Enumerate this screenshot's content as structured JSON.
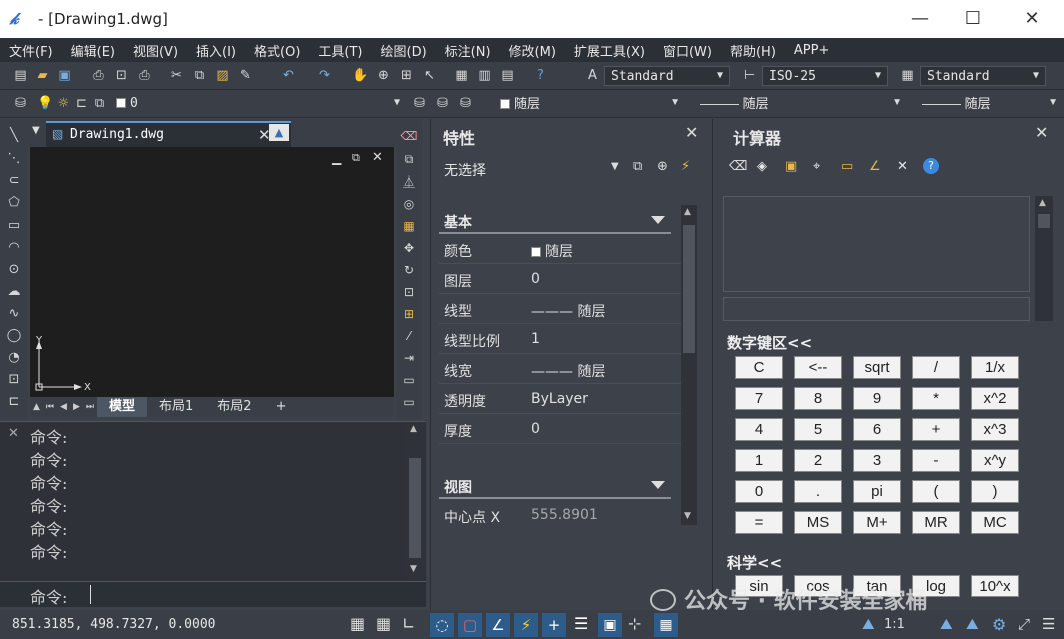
{
  "window": {
    "title": "- [Drawing1.dwg]",
    "logo": "𝓀",
    "min": "—",
    "max": "☐",
    "close": "✕"
  },
  "menu": [
    "文件(F)",
    "编辑(E)",
    "视图(V)",
    "插入(I)",
    "格式(O)",
    "工具(T)",
    "绘图(D)",
    "标注(N)",
    "修改(M)",
    "扩展工具(X)",
    "窗口(W)",
    "帮助(H)",
    "APP+"
  ],
  "toolbar1": {
    "text_style": "Standard",
    "dim_style": "ISO-25",
    "table_style": "Standard"
  },
  "toolbar2": {
    "layer": "0",
    "color": "随层",
    "linetype": "——— 随层",
    "lineweight": "——— 随层"
  },
  "doc": {
    "tab_label": "Drawing1.dwg",
    "close": "✕",
    "axis_y": "Y",
    "axis_x": "X"
  },
  "layout_tabs": [
    "模型",
    "布局1",
    "布局2",
    "+"
  ],
  "command": {
    "lines": [
      "命令:",
      "命令:",
      "命令:",
      "命令:",
      "命令:",
      "命令:"
    ],
    "prompt": "命令:"
  },
  "status": {
    "coords": "851.3185, 498.7327, 0.0000",
    "scale": "1:1"
  },
  "properties": {
    "title": "特性",
    "selection": "无选择",
    "section_basic": "基本",
    "rows": [
      {
        "k": "颜色",
        "v": "随层"
      },
      {
        "k": "图层",
        "v": "0"
      },
      {
        "k": "线型",
        "v": "——— 随层"
      },
      {
        "k": "线型比例",
        "v": "1"
      },
      {
        "k": "线宽",
        "v": "——— 随层"
      },
      {
        "k": "透明度",
        "v": "ByLayer"
      },
      {
        "k": "厚度",
        "v": "0"
      }
    ],
    "section_view": "视图",
    "view_rows": [
      {
        "k": "中心点 X",
        "v": "555.8901"
      }
    ]
  },
  "calculator": {
    "title": "计算器",
    "numpad_label": "数字键区<<",
    "keys": [
      [
        "C",
        "<--",
        "sqrt",
        "/",
        "1/x"
      ],
      [
        "7",
        "8",
        "9",
        "*",
        "x^2"
      ],
      [
        "4",
        "5",
        "6",
        "+",
        "x^3"
      ],
      [
        "1",
        "2",
        "3",
        "-",
        "x^y"
      ],
      [
        "0",
        ".",
        "pi",
        "(",
        ")"
      ],
      [
        "=",
        "MS",
        "M+",
        "MR",
        "MC"
      ]
    ],
    "sci_label": "科学<<",
    "sci_keys": [
      "sin",
      "cos",
      "tan",
      "log",
      "10^x"
    ]
  },
  "watermark": "公众号 · 软件安装全家桶"
}
